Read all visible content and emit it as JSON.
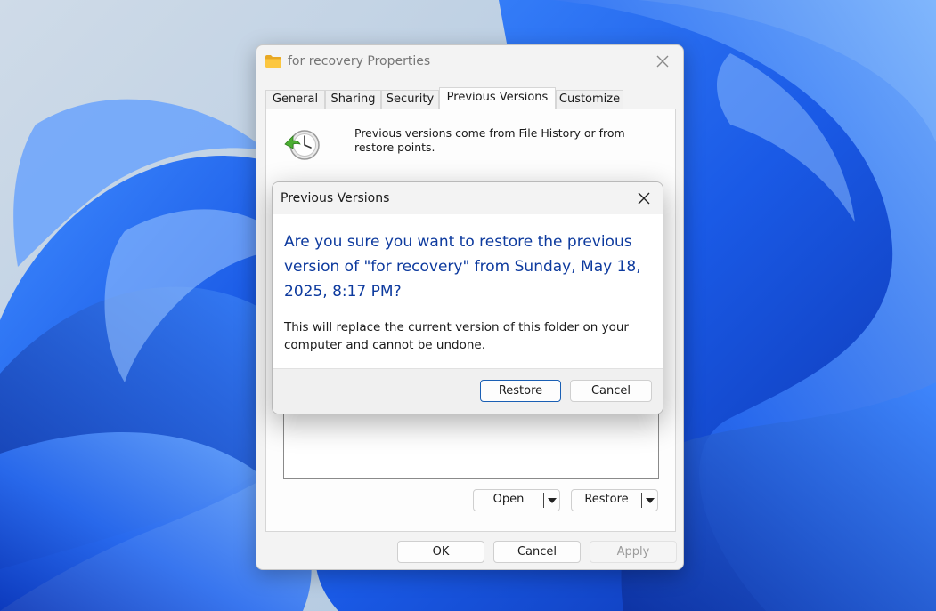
{
  "window": {
    "title": "for recovery Properties",
    "tabs": [
      {
        "label": "General"
      },
      {
        "label": "Sharing"
      },
      {
        "label": "Security"
      },
      {
        "label": "Previous Versions"
      },
      {
        "label": "Customize"
      }
    ],
    "active_tab": "Previous Versions",
    "info_text": "Previous versions come from File History or from restore points.",
    "open_button": "Open",
    "restore_button": "Restore",
    "footer": {
      "ok": "OK",
      "cancel": "Cancel",
      "apply": "Apply"
    }
  },
  "dialog": {
    "title": "Previous Versions",
    "heading": "Are you sure you want to restore the previous version of \"for recovery\" from Sunday, May 18, 2025, 8:17 PM?",
    "body": "This will replace the current version of this folder on your computer and cannot be undone.",
    "restore_button": "Restore",
    "cancel_button": "Cancel"
  },
  "colors": {
    "heading_blue": "#0d3a9e",
    "accent_blue": "#1a5fb4",
    "wallpaper_blue": "#1d5fe0"
  },
  "icons": {
    "title": "folder-icon",
    "close": "close-icon",
    "previous_versions": "restore-clock-icon",
    "dropdown": "chevron-down-icon"
  }
}
